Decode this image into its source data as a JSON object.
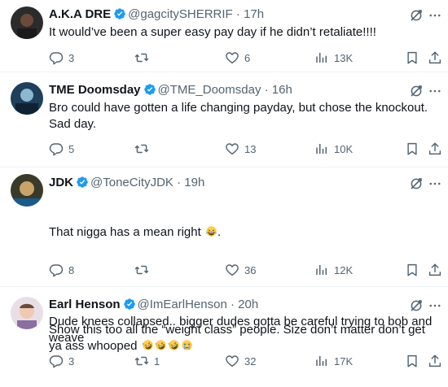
{
  "colors": {
    "verified": "#1d9bf0",
    "muted": "#536471",
    "text": "#0f1419"
  },
  "tweets": [
    {
      "name": "A.K.A DRE",
      "handle": "@gagcitySHERRIF",
      "dot": "·",
      "time": "17h",
      "text": "It would’ve been a super easy pay day if he didn’t retaliate!!!!",
      "replies": "3",
      "reposts": "",
      "likes": "6",
      "views": "13K"
    },
    {
      "name": "TME Doomsday",
      "handle": "@TME_Doomsday",
      "dot": "·",
      "time": "16h",
      "text": "Bro could have gotten a life changing payday, but chose the knockout.  Sad day.",
      "replies": "5",
      "reposts": "",
      "likes": "13",
      "views": "10K"
    },
    {
      "name": "JDK",
      "handle": "@ToneCityJDK",
      "dot": "·",
      "time": "19h",
      "text_line1": "That nigga has a mean right",
      "text_line1_end": ".",
      "text_line2": "Show this too all the “weight class” people. Size don’t matter don’t get ya ass whooped",
      "replies": "8",
      "reposts": "",
      "likes": "36",
      "views": "12K"
    },
    {
      "name": "Earl Henson",
      "handle": "@ImEarlHenson",
      "dot": "·",
      "time": "20h",
      "text": "Dude knees collapsed.. bigger dudes gotta be careful trying to bob and weave",
      "replies": "3",
      "reposts": "1",
      "likes": "32",
      "views": "17K"
    }
  ]
}
